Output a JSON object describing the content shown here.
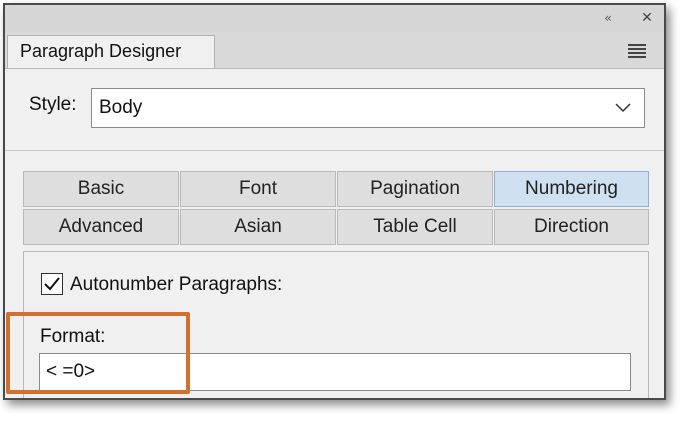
{
  "panel": {
    "tab_label": "Paragraph Designer",
    "collapse_icon": "collapse-double-chevron-icon",
    "close_icon": "close-icon",
    "menu_icon": "hamburger-menu-icon"
  },
  "style": {
    "label": "Style:",
    "value": "Body"
  },
  "tabs": [
    {
      "label": "Basic",
      "active": false
    },
    {
      "label": "Font",
      "active": false
    },
    {
      "label": "Pagination",
      "active": false
    },
    {
      "label": "Numbering",
      "active": true
    },
    {
      "label": "Advanced",
      "active": false
    },
    {
      "label": "Asian",
      "active": false
    },
    {
      "label": "Table Cell",
      "active": false
    },
    {
      "label": "Direction",
      "active": false
    }
  ],
  "numbering": {
    "autonumber_label": "Autonumber Paragraphs:",
    "autonumber_checked": true,
    "format_label": "Format:",
    "format_value": "< =0>"
  },
  "colors": {
    "highlight": "#d36f2f",
    "active_tab": "#cfe0f1"
  }
}
